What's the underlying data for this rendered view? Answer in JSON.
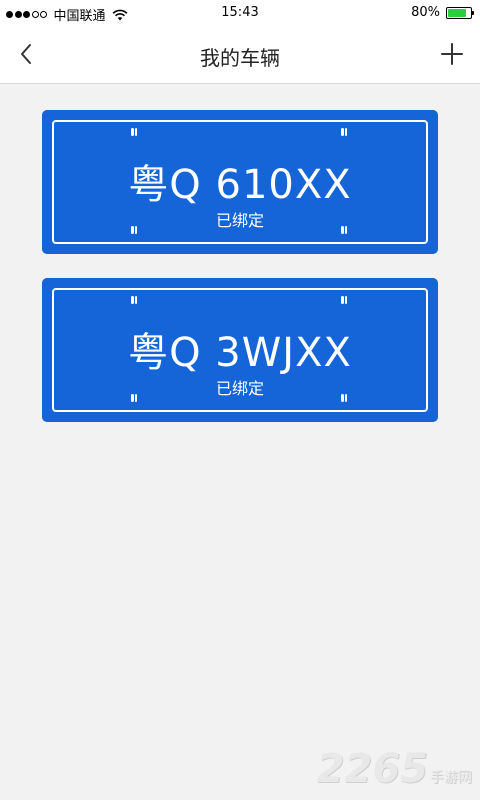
{
  "status_bar": {
    "carrier": "中国联通",
    "time": "15:43",
    "battery": "80%",
    "battery_level": 0.8
  },
  "nav": {
    "title": "我的车辆"
  },
  "plates": [
    {
      "number": "粤Q 610XX",
      "status": "已绑定"
    },
    {
      "number": "粤Q 3WJXX",
      "status": "已绑定"
    }
  ],
  "watermark": {
    "number": "2265",
    "text": "手游网"
  }
}
